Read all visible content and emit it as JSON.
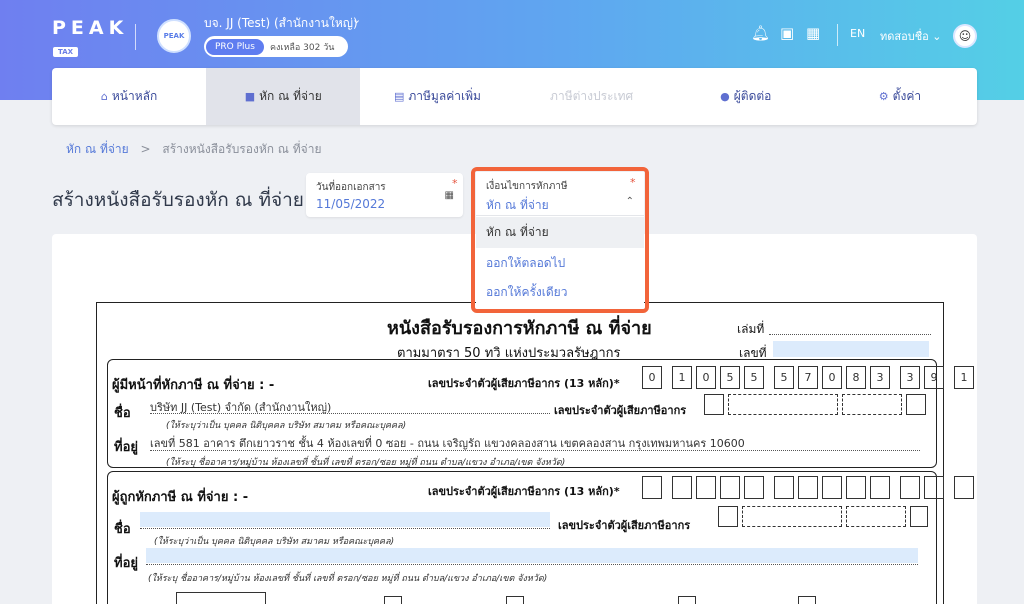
{
  "brand": {
    "name": "PEAK",
    "sub": "TAX"
  },
  "company": {
    "name": "บจ. JJ (Test) (สำนักงานใหญ่)",
    "plan": "PRO Plus",
    "plan_left": "คงเหลือ 302 วัน",
    "logo_text": "PEAK"
  },
  "header": {
    "lang": "EN",
    "user": "ทดสอบชื่อ"
  },
  "nav": {
    "home": "หน้าหลัก",
    "wht": "หัก ณ ที่จ่าย",
    "vat": "ภาษีมูลค่าเพิ่ม",
    "foreign": "ภาษีต่างประเทศ",
    "contacts": "ผู้ติดต่อ",
    "settings": "ตั้งค่า"
  },
  "breadcrumb": {
    "parent": "หัก ณ ที่จ่าย",
    "sep": ">",
    "current": "สร้างหนังสือรับรองหัก ณ ที่จ่าย"
  },
  "page": {
    "title": "สร้างหนังสือรับรองหัก ณ ที่จ่าย"
  },
  "date_field": {
    "label": "วันที่ออกเอกสาร",
    "value": "11/05/2022",
    "required": "*"
  },
  "condition_field": {
    "label": "เงื่อนไขการหักภาษี",
    "value": "หัก ณ ที่จ่าย",
    "required": "*",
    "options": [
      "หัก ณ ที่จ่าย",
      "ออกให้ตลอดไป",
      "ออกให้ครั้งเดียว"
    ]
  },
  "form": {
    "title": "หนังสือรับรองการหักภาษี ณ ที่จ่าย",
    "subtitle": "ตามมาตรา 50 ทวิ แห่งประมวลรัษฎากร",
    "book_label": "เล่มที่",
    "no_label": "เลขที่",
    "payer": {
      "heading": "ผู้มีหน้าที่หักภาษี ณ ที่จ่าย : -",
      "tax13_label": "เลขประจำตัวผู้เสียภาษีอากร (13 หลัก)*",
      "tax_digits": [
        "0",
        "1",
        "0",
        "5",
        "5",
        "5",
        "7",
        "0",
        "8",
        "3",
        "3",
        "9",
        "1"
      ],
      "name_label": "ชื่อ",
      "name_value": "บริษัท JJ (Test) จำกัด (สำนักงานใหญ่)",
      "taxid_label": "เลขประจำตัวผู้เสียภาษีอากร",
      "name_note": "(ให้ระบุว่าเป็น บุคคล นิติบุคคล บริษัท สมาคม หรือคณะบุคคล)",
      "addr_label": "ที่อยู่",
      "addr_value": "เลขที่ 581 อาคาร ตึกเยาวราช ชั้น 4 ห้องเลขที่ 0 ซอย - ถนน เจริญรัถ แขวงคลองสาน เขตคลองสาน กรุงเทพมหานคร 10600",
      "addr_note": "(ให้ระบุ ชื่ออาคาร/หมู่บ้าน ห้องเลขที่ ชั้นที่ เลขที่ ตรอก/ซอย หมู่ที่ ถนน ตำบล/แขวง อำเภอ/เขต จังหวัด)"
    },
    "payee": {
      "heading": "ผู้ถูกหักภาษี ณ ที่จ่าย : -",
      "tax13_label": "เลขประจำตัวผู้เสียภาษีอากร (13 หลัก)*",
      "name_label": "ชื่อ",
      "taxid_label": "เลขประจำตัวผู้เสียภาษีอากร",
      "name_note": "(ให้ระบุว่าเป็น บุคคล นิติบุคคล บริษัท สมาคม หรือคณะบุคคล)",
      "addr_label": "ที่อยู่",
      "addr_note": "(ให้ระบุ ชื่ออาคาร/หมู่บ้าน ห้องเลขที่ ชั้นที่ เลขที่ ตรอก/ซอย หมู่ที่ ถนน ตำบล/แขวง อำเภอ/เขต จังหวัด)"
    }
  }
}
